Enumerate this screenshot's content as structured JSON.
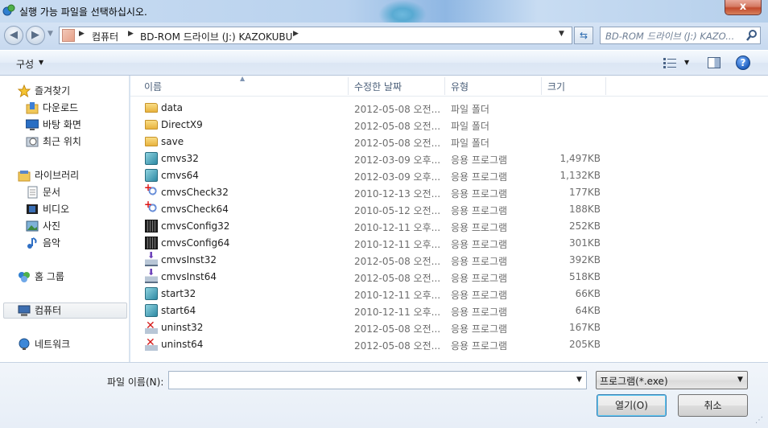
{
  "window": {
    "title": "실행 가능 파일을 선택하십시오.",
    "close_label": "x"
  },
  "address": {
    "crumbs": [
      "컴퓨터",
      "BD-ROM 드라이브 (J:) KAZOKUBU"
    ],
    "search_placeholder": "BD-ROM 드라이브 (J:) KAZO..."
  },
  "toolbar": {
    "organize": "구성",
    "help": "?"
  },
  "nav": {
    "favorites": "즐겨찾기",
    "downloads": "다운로드",
    "desktop": "바탕 화면",
    "recent": "최근 위치",
    "libraries": "라이브러리",
    "documents": "문서",
    "videos": "비디오",
    "pictures": "사진",
    "music": "음악",
    "homegroup": "홈 그룹",
    "computer": "컴퓨터",
    "network": "네트워크"
  },
  "columns": {
    "name": "이름",
    "date": "수정한 날짜",
    "type": "유형",
    "size": "크기"
  },
  "files": [
    {
      "name": "data",
      "date": "2012-05-08 오전...",
      "type": "파일 폴더",
      "size": "",
      "icon": "folder-icon"
    },
    {
      "name": "DirectX9",
      "date": "2012-05-08 오전...",
      "type": "파일 폴더",
      "size": "",
      "icon": "folder-icon"
    },
    {
      "name": "save",
      "date": "2012-05-08 오전...",
      "type": "파일 폴더",
      "size": "",
      "icon": "folder-icon"
    },
    {
      "name": "cmvs32",
      "date": "2012-03-09 오후...",
      "type": "응용 프로그램",
      "size": "1,497KB",
      "icon": "app-icon"
    },
    {
      "name": "cmvs64",
      "date": "2012-03-09 오후...",
      "type": "응용 프로그램",
      "size": "1,132KB",
      "icon": "app-icon"
    },
    {
      "name": "cmvsCheck32",
      "date": "2010-12-13 오전...",
      "type": "응용 프로그램",
      "size": "177KB",
      "icon": "check-icon"
    },
    {
      "name": "cmvsCheck64",
      "date": "2010-05-12 오전...",
      "type": "응용 프로그램",
      "size": "188KB",
      "icon": "check-icon"
    },
    {
      "name": "cmvsConfig32",
      "date": "2010-12-11 오후...",
      "type": "응용 프로그램",
      "size": "252KB",
      "icon": "config-icon"
    },
    {
      "name": "cmvsConfig64",
      "date": "2010-12-11 오후...",
      "type": "응용 프로그램",
      "size": "301KB",
      "icon": "config-icon"
    },
    {
      "name": "cmvsInst32",
      "date": "2012-05-08 오전...",
      "type": "응용 프로그램",
      "size": "392KB",
      "icon": "install-icon"
    },
    {
      "name": "cmvsInst64",
      "date": "2012-05-08 오전...",
      "type": "응용 프로그램",
      "size": "518KB",
      "icon": "install-icon"
    },
    {
      "name": "start32",
      "date": "2010-12-11 오후...",
      "type": "응용 프로그램",
      "size": "66KB",
      "icon": "app-icon"
    },
    {
      "name": "start64",
      "date": "2010-12-11 오후...",
      "type": "응용 프로그램",
      "size": "64KB",
      "icon": "app-icon"
    },
    {
      "name": "uninst32",
      "date": "2012-05-08 오전...",
      "type": "응용 프로그램",
      "size": "167KB",
      "icon": "uninstall-icon"
    },
    {
      "name": "uninst64",
      "date": "2012-05-08 오전...",
      "type": "응용 프로그램",
      "size": "205KB",
      "icon": "uninstall-icon"
    }
  ],
  "footer": {
    "filename_label": "파일 이름(N):",
    "filename_value": "",
    "filter": "프로그램(*.exe)",
    "open": "열기(O)",
    "cancel": "취소"
  }
}
